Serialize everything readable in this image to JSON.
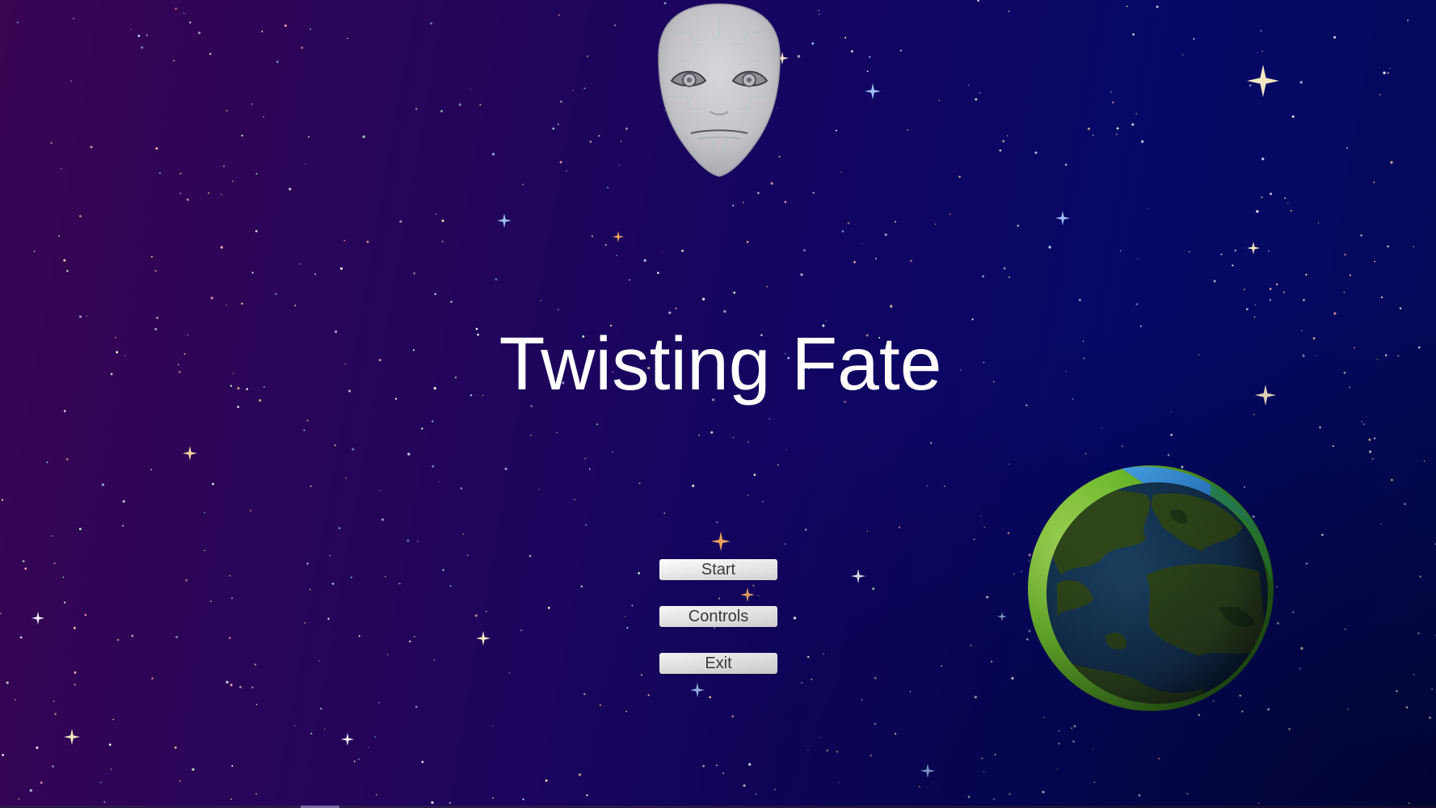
{
  "game": {
    "title": "Twisting Fate"
  },
  "menu": {
    "buttons": [
      {
        "id": "start",
        "label": "Start"
      },
      {
        "id": "controls",
        "label": "Controls"
      },
      {
        "id": "exit",
        "label": "Exit"
      }
    ]
  },
  "scene": {
    "background_colors": [
      "#3a0553",
      "#120561",
      "#040a56"
    ],
    "mask_color": "#c9c9cd",
    "planet_ocean_color": "#1f4a6e",
    "planet_land_color": "#3a5a1a",
    "planet_rim_color": "#8ee03a",
    "planet_atmosphere_color": "#3aa0f0"
  }
}
